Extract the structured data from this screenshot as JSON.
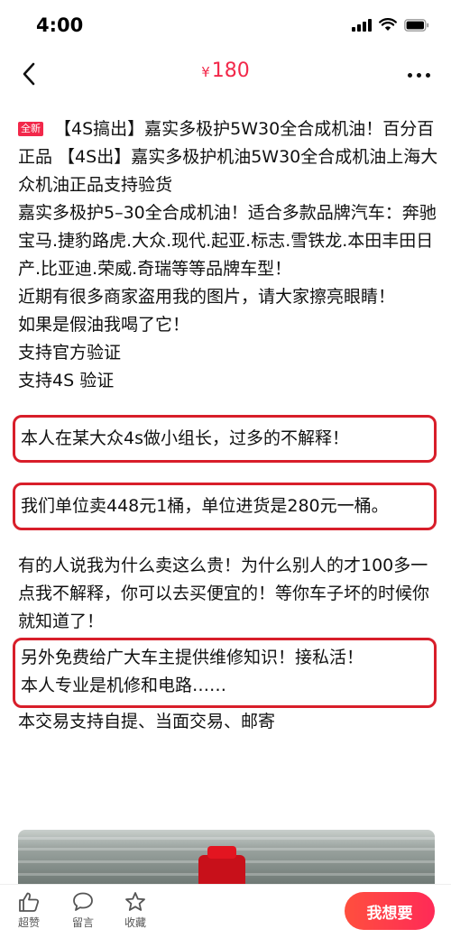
{
  "status_bar": {
    "time": "4:00"
  },
  "header": {
    "currency": "¥",
    "price": "180"
  },
  "post": {
    "badge": "全新",
    "lines": [
      "【4S搞出】嘉实多极护5W30全合成机油！百分百正品 【4S出】嘉实多极护机油5W30全合成机油上海大众机油正品支持验货",
      "嘉实多极护5–30全合成机油！适合多款品牌汽车：奔驰宝马.捷豹路虎.大众.现代.起亚.标志.雪铁龙.本田丰田日产.比亚迪.荣威.奇瑞等等品牌车型！",
      "近期有很多商家盗用我的图片，请大家擦亮眼睛！",
      "如果是假油我喝了它！",
      "支持官方验证",
      "支持4S 验证"
    ],
    "highlight_1": "本人在某大众4s做小组长，过多的不解释！",
    "highlight_2": "我们单位卖448元1桶，单位进货是280元一桶。",
    "paragraph_2": "有的人说我为什么卖这么贵！为什么别人的才100多一点我不解释，你可以去买便宜的！等你车子坏的时候你就知道了！",
    "highlight_3_line_1": "另外免费给广大车主提供维修知识！接私活！",
    "highlight_3_line_2": "本人专业是机修和电路……",
    "footer_line": "本交易支持自提、当面交易、邮寄"
  },
  "bottom_bar": {
    "like_label": "超赞",
    "comment_label": "留言",
    "favorite_label": "收藏",
    "want_label": "我想要"
  },
  "colors": {
    "accent": "#f2284a",
    "highlight_border": "#d81e2a"
  },
  "icons": {
    "back": "chevron-left-icon",
    "more": "more-dots-icon",
    "like": "thumbs-up-icon",
    "comment": "speech-bubble-icon",
    "favorite": "star-icon"
  }
}
